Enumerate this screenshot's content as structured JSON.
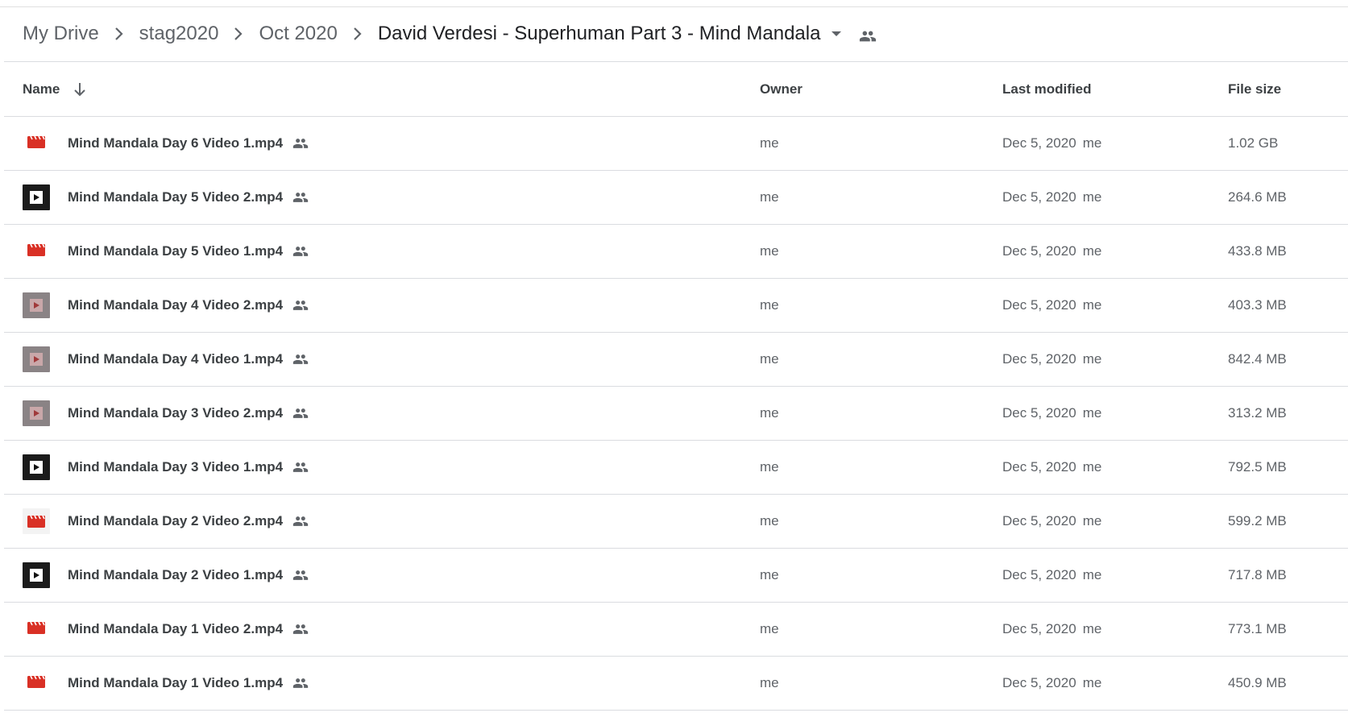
{
  "breadcrumb": {
    "items": [
      "My Drive",
      "stag2020",
      "Oct 2020"
    ],
    "current": "David Verdesi - Superhuman Part 3 - Mind Mandala"
  },
  "columns": {
    "name": "Name",
    "owner": "Owner",
    "last_modified": "Last modified",
    "file_size": "File size"
  },
  "colors": {
    "video_red": "#d93025",
    "icon_gray": "#5f6368",
    "divider": "#dadce0"
  },
  "files": [
    {
      "name": "Mind Mandala Day 6 Video 1.mp4",
      "thumb": "video-file-icon",
      "owner": "me",
      "modified": "Dec 5, 2020",
      "modified_by": "me",
      "size": "1.02 GB"
    },
    {
      "name": "Mind Mandala Day 5 Video 2.mp4",
      "thumb": "video-thumbnail-dark",
      "owner": "me",
      "modified": "Dec 5, 2020",
      "modified_by": "me",
      "size": "264.6 MB"
    },
    {
      "name": "Mind Mandala Day 5 Video 1.mp4",
      "thumb": "video-file-icon",
      "owner": "me",
      "modified": "Dec 5, 2020",
      "modified_by": "me",
      "size": "433.8 MB"
    },
    {
      "name": "Mind Mandala Day 4 Video 2.mp4",
      "thumb": "video-thumbnail-gray",
      "owner": "me",
      "modified": "Dec 5, 2020",
      "modified_by": "me",
      "size": "403.3 MB"
    },
    {
      "name": "Mind Mandala Day 4 Video 1.mp4",
      "thumb": "video-thumbnail-gray",
      "owner": "me",
      "modified": "Dec 5, 2020",
      "modified_by": "me",
      "size": "842.4 MB"
    },
    {
      "name": "Mind Mandala Day 3 Video 2.mp4",
      "thumb": "video-thumbnail-gray",
      "owner": "me",
      "modified": "Dec 5, 2020",
      "modified_by": "me",
      "size": "313.2 MB"
    },
    {
      "name": "Mind Mandala Day 3 Video 1.mp4",
      "thumb": "video-thumbnail-dark",
      "owner": "me",
      "modified": "Dec 5, 2020",
      "modified_by": "me",
      "size": "792.5 MB"
    },
    {
      "name": "Mind Mandala Day 2 Video 2.mp4",
      "thumb": "video-thumbnail-light",
      "owner": "me",
      "modified": "Dec 5, 2020",
      "modified_by": "me",
      "size": "599.2 MB"
    },
    {
      "name": "Mind Mandala Day 2 Video 1.mp4",
      "thumb": "video-thumbnail-dark",
      "owner": "me",
      "modified": "Dec 5, 2020",
      "modified_by": "me",
      "size": "717.8 MB"
    },
    {
      "name": "Mind Mandala Day 1 Video 2.mp4",
      "thumb": "video-file-icon",
      "owner": "me",
      "modified": "Dec 5, 2020",
      "modified_by": "me",
      "size": "773.1 MB"
    },
    {
      "name": "Mind Mandala Day 1 Video 1.mp4",
      "thumb": "video-file-icon",
      "owner": "me",
      "modified": "Dec 5, 2020",
      "modified_by": "me",
      "size": "450.9 MB"
    }
  ]
}
